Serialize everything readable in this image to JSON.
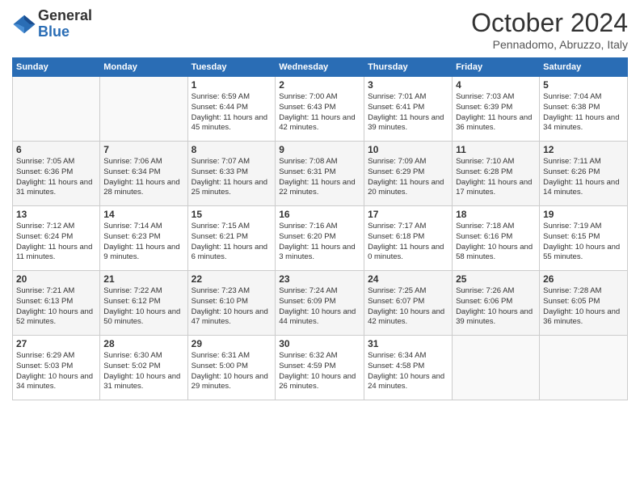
{
  "header": {
    "logo_line1": "General",
    "logo_line2": "Blue",
    "month": "October 2024",
    "location": "Pennadomo, Abruzzo, Italy"
  },
  "weekdays": [
    "Sunday",
    "Monday",
    "Tuesday",
    "Wednesday",
    "Thursday",
    "Friday",
    "Saturday"
  ],
  "weeks": [
    [
      {
        "day": "",
        "info": ""
      },
      {
        "day": "",
        "info": ""
      },
      {
        "day": "1",
        "info": "Sunrise: 6:59 AM\nSunset: 6:44 PM\nDaylight: 11 hours and 45 minutes."
      },
      {
        "day": "2",
        "info": "Sunrise: 7:00 AM\nSunset: 6:43 PM\nDaylight: 11 hours and 42 minutes."
      },
      {
        "day": "3",
        "info": "Sunrise: 7:01 AM\nSunset: 6:41 PM\nDaylight: 11 hours and 39 minutes."
      },
      {
        "day": "4",
        "info": "Sunrise: 7:03 AM\nSunset: 6:39 PM\nDaylight: 11 hours and 36 minutes."
      },
      {
        "day": "5",
        "info": "Sunrise: 7:04 AM\nSunset: 6:38 PM\nDaylight: 11 hours and 34 minutes."
      }
    ],
    [
      {
        "day": "6",
        "info": "Sunrise: 7:05 AM\nSunset: 6:36 PM\nDaylight: 11 hours and 31 minutes."
      },
      {
        "day": "7",
        "info": "Sunrise: 7:06 AM\nSunset: 6:34 PM\nDaylight: 11 hours and 28 minutes."
      },
      {
        "day": "8",
        "info": "Sunrise: 7:07 AM\nSunset: 6:33 PM\nDaylight: 11 hours and 25 minutes."
      },
      {
        "day": "9",
        "info": "Sunrise: 7:08 AM\nSunset: 6:31 PM\nDaylight: 11 hours and 22 minutes."
      },
      {
        "day": "10",
        "info": "Sunrise: 7:09 AM\nSunset: 6:29 PM\nDaylight: 11 hours and 20 minutes."
      },
      {
        "day": "11",
        "info": "Sunrise: 7:10 AM\nSunset: 6:28 PM\nDaylight: 11 hours and 17 minutes."
      },
      {
        "day": "12",
        "info": "Sunrise: 7:11 AM\nSunset: 6:26 PM\nDaylight: 11 hours and 14 minutes."
      }
    ],
    [
      {
        "day": "13",
        "info": "Sunrise: 7:12 AM\nSunset: 6:24 PM\nDaylight: 11 hours and 11 minutes."
      },
      {
        "day": "14",
        "info": "Sunrise: 7:14 AM\nSunset: 6:23 PM\nDaylight: 11 hours and 9 minutes."
      },
      {
        "day": "15",
        "info": "Sunrise: 7:15 AM\nSunset: 6:21 PM\nDaylight: 11 hours and 6 minutes."
      },
      {
        "day": "16",
        "info": "Sunrise: 7:16 AM\nSunset: 6:20 PM\nDaylight: 11 hours and 3 minutes."
      },
      {
        "day": "17",
        "info": "Sunrise: 7:17 AM\nSunset: 6:18 PM\nDaylight: 11 hours and 0 minutes."
      },
      {
        "day": "18",
        "info": "Sunrise: 7:18 AM\nSunset: 6:16 PM\nDaylight: 10 hours and 58 minutes."
      },
      {
        "day": "19",
        "info": "Sunrise: 7:19 AM\nSunset: 6:15 PM\nDaylight: 10 hours and 55 minutes."
      }
    ],
    [
      {
        "day": "20",
        "info": "Sunrise: 7:21 AM\nSunset: 6:13 PM\nDaylight: 10 hours and 52 minutes."
      },
      {
        "day": "21",
        "info": "Sunrise: 7:22 AM\nSunset: 6:12 PM\nDaylight: 10 hours and 50 minutes."
      },
      {
        "day": "22",
        "info": "Sunrise: 7:23 AM\nSunset: 6:10 PM\nDaylight: 10 hours and 47 minutes."
      },
      {
        "day": "23",
        "info": "Sunrise: 7:24 AM\nSunset: 6:09 PM\nDaylight: 10 hours and 44 minutes."
      },
      {
        "day": "24",
        "info": "Sunrise: 7:25 AM\nSunset: 6:07 PM\nDaylight: 10 hours and 42 minutes."
      },
      {
        "day": "25",
        "info": "Sunrise: 7:26 AM\nSunset: 6:06 PM\nDaylight: 10 hours and 39 minutes."
      },
      {
        "day": "26",
        "info": "Sunrise: 7:28 AM\nSunset: 6:05 PM\nDaylight: 10 hours and 36 minutes."
      }
    ],
    [
      {
        "day": "27",
        "info": "Sunrise: 6:29 AM\nSunset: 5:03 PM\nDaylight: 10 hours and 34 minutes."
      },
      {
        "day": "28",
        "info": "Sunrise: 6:30 AM\nSunset: 5:02 PM\nDaylight: 10 hours and 31 minutes."
      },
      {
        "day": "29",
        "info": "Sunrise: 6:31 AM\nSunset: 5:00 PM\nDaylight: 10 hours and 29 minutes."
      },
      {
        "day": "30",
        "info": "Sunrise: 6:32 AM\nSunset: 4:59 PM\nDaylight: 10 hours and 26 minutes."
      },
      {
        "day": "31",
        "info": "Sunrise: 6:34 AM\nSunset: 4:58 PM\nDaylight: 10 hours and 24 minutes."
      },
      {
        "day": "",
        "info": ""
      },
      {
        "day": "",
        "info": ""
      }
    ]
  ]
}
